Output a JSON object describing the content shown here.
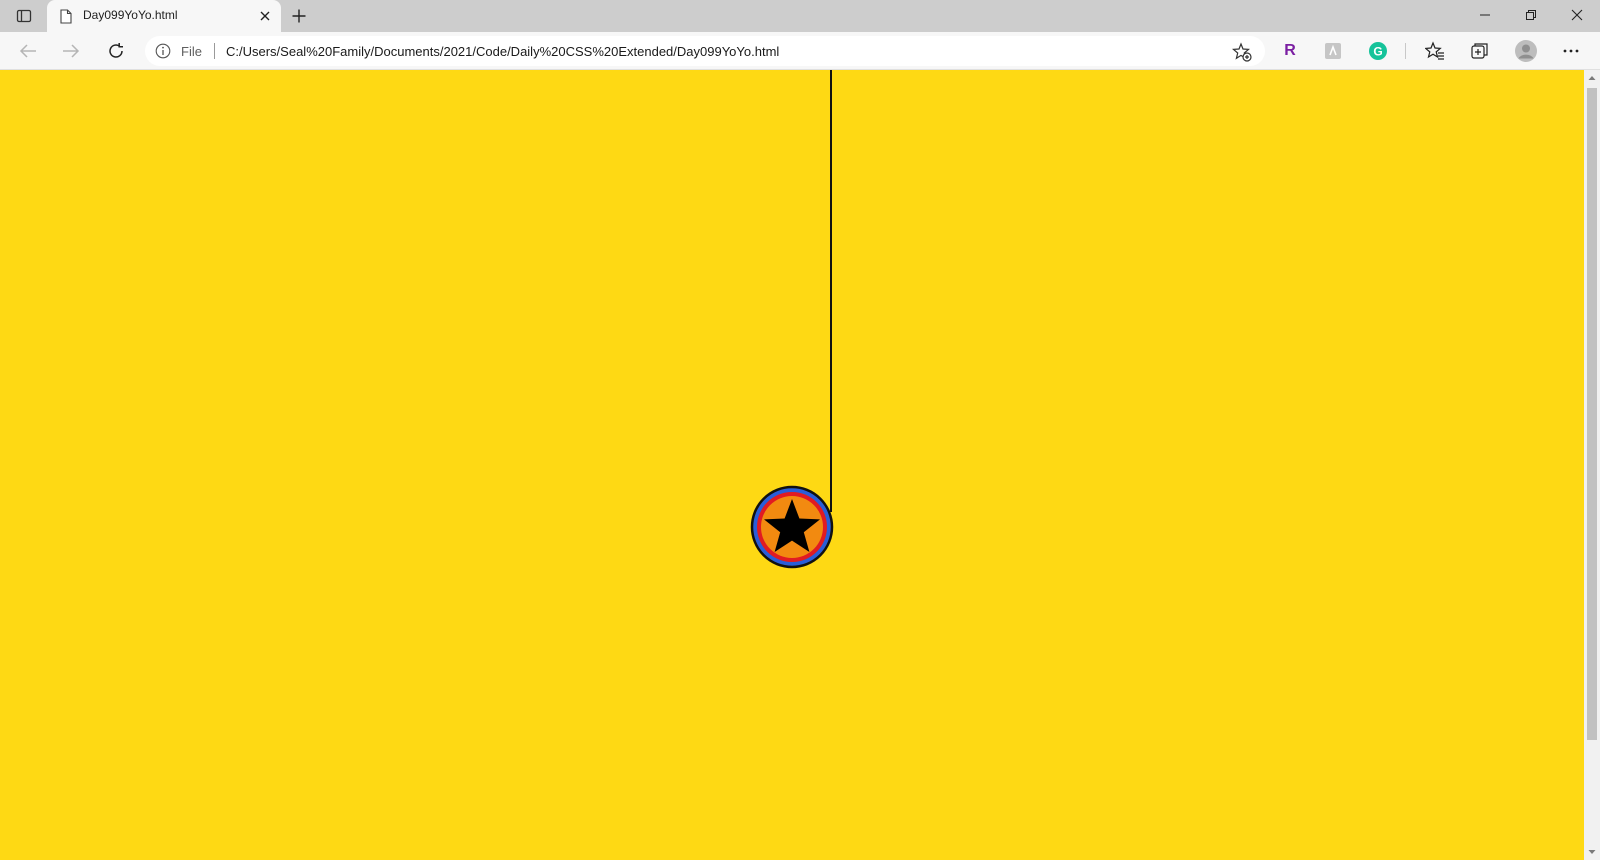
{
  "tab": {
    "title": "Day099YoYo.html",
    "favicon": "page-icon"
  },
  "tab_strip": {
    "actions_icon": "tab-actions-icon",
    "new_tab_icon": "plus-icon"
  },
  "window_controls": {
    "minimize_icon": "minimize-icon",
    "restore_icon": "restore-icon",
    "close_icon": "close-icon"
  },
  "address_bar": {
    "scheme_label": "File",
    "url": "C:/Users/Seal%20Family/Documents/2021/Code/Daily%20CSS%20Extended/Day099YoYo.html",
    "info_icon": "info-icon",
    "favorite_icon": "add-favorite-icon"
  },
  "navigation": {
    "back_icon": "back-arrow-icon",
    "forward_icon": "forward-arrow-icon",
    "refresh_icon": "refresh-icon"
  },
  "extensions": {
    "r_label": "R",
    "g_label": "G"
  },
  "colors": {
    "page_background": "#fed914",
    "yoyo_outer": "#2a5ed8",
    "yoyo_ring": "#e11b22",
    "yoyo_body": "#f28a10",
    "yoyo_star": "#000000",
    "string": "#111111",
    "ext_r": "#7b1fa2",
    "ext_g": "#15c39a"
  }
}
